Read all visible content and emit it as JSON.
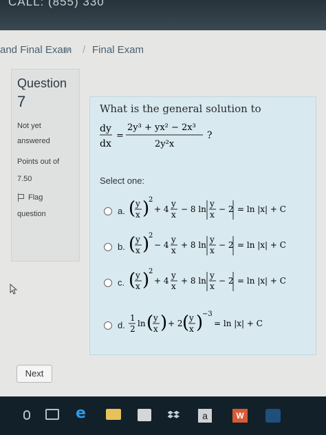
{
  "top": {
    "call_text": "CALL: (855) 330"
  },
  "breadcrumb": {
    "first": "and Final Exam",
    "separator": "▶",
    "slash": "/",
    "current": "Final Exam"
  },
  "sidebar": {
    "question_label": "Question",
    "question_number": "7",
    "status_line1": "Not yet",
    "status_line2": "answered",
    "points_label": "Points out of",
    "points_value": "7.50",
    "flag_line1": "Flag",
    "flag_line2": "question"
  },
  "question": {
    "prompt": "What is the general solution to",
    "select_one": "Select one:",
    "options": [
      {
        "letter": "a."
      },
      {
        "letter": "b."
      },
      {
        "letter": "c."
      },
      {
        "letter": "d."
      }
    ]
  },
  "next_button": {
    "label": "Next"
  },
  "taskbar": {
    "icons": [
      "microphone-icon",
      "task-view-icon",
      "edge-icon",
      "file-explorer-icon",
      "store-icon",
      "dropbox-icon",
      "amazon-icon",
      "word-icon",
      "app-icon"
    ],
    "edge_glyph": "e",
    "amazon_glyph": "a",
    "word_glyph": "W"
  },
  "colors": {
    "page_bg": "#e6e7e5",
    "question_bg": "#d8e9f0",
    "taskbar_bg": "#12202a"
  }
}
